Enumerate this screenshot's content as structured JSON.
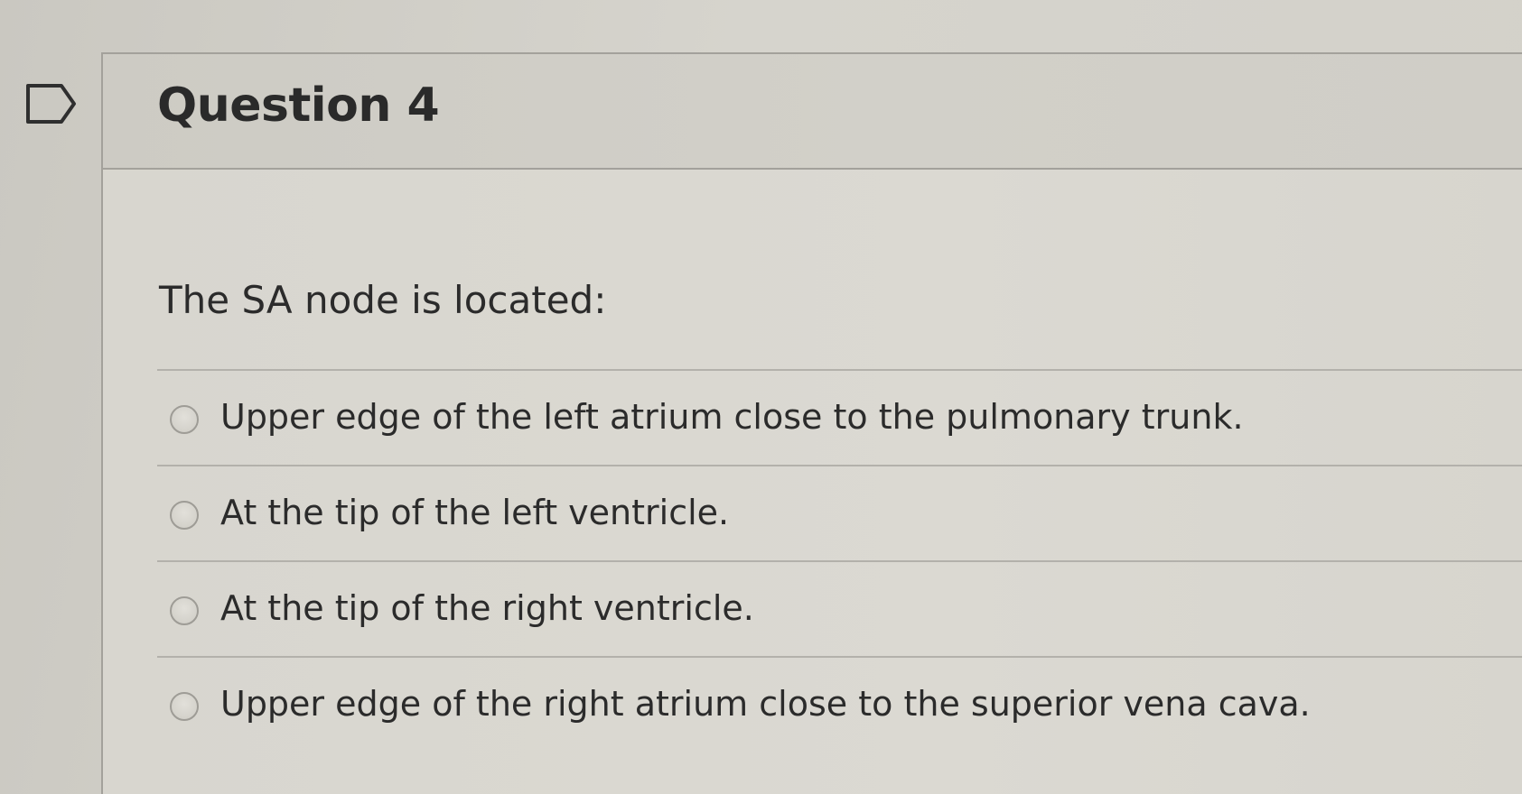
{
  "question": {
    "title": "Question 4",
    "prompt": "The SA node is located:",
    "answers": [
      {
        "label": "Upper edge of the left atrium close to the pulmonary trunk."
      },
      {
        "label": "At the tip of the left ventricle."
      },
      {
        "label": "At the tip of the right ventricle."
      },
      {
        "label": "Upper edge of the right atrium close to the superior vena cava."
      }
    ]
  },
  "flag": {
    "icon": "flag-question-icon"
  },
  "colors": {
    "background": "#d3d1ca",
    "header": "#d0cec7",
    "border": "#a3a19b",
    "text": "#2b2b2b"
  }
}
